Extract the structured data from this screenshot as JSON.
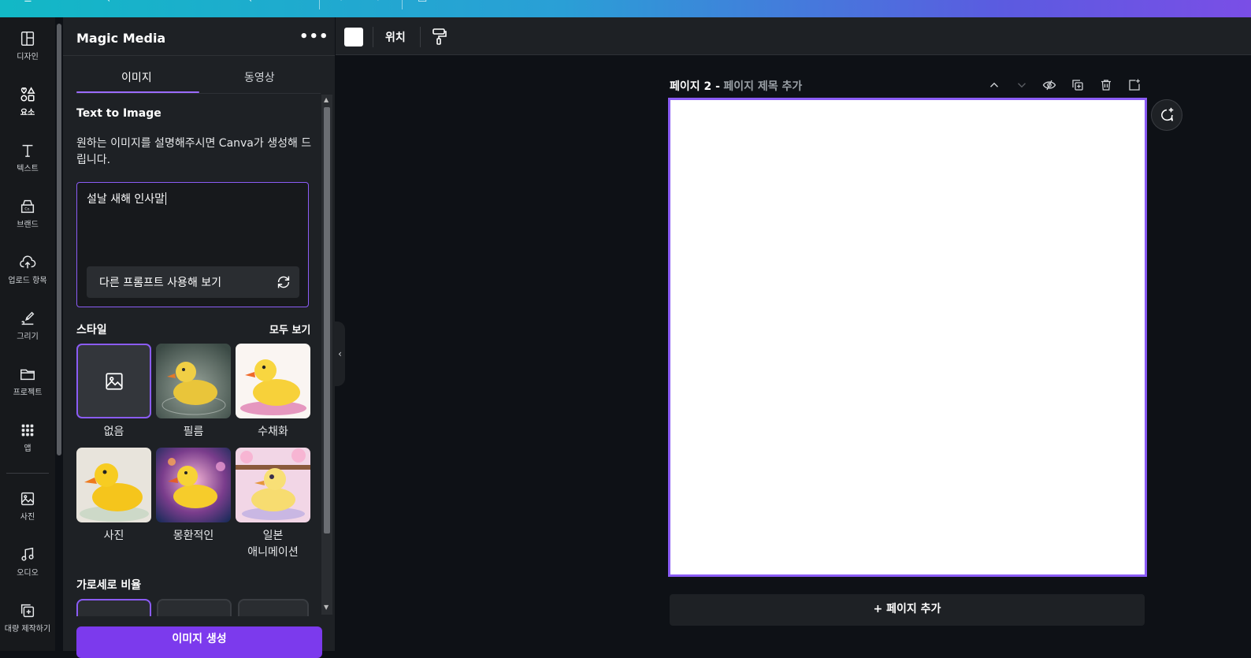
{
  "app": {
    "accent_color": "#8b5cf6",
    "button_color": "#7c3aed"
  },
  "topbar": {
    "gradient": [
      "#12b8c6",
      "#7a4ee6"
    ]
  },
  "rail": {
    "items": [
      {
        "label": "디자인",
        "icon": "layout-icon"
      },
      {
        "label": "요소",
        "icon": "shapes-icon"
      },
      {
        "label": "텍스트",
        "icon": "text-icon"
      },
      {
        "label": "브랜드",
        "icon": "brand-icon"
      },
      {
        "label": "업로드 항목",
        "icon": "upload-icon"
      },
      {
        "label": "그리기",
        "icon": "draw-icon"
      },
      {
        "label": "프로젝트",
        "icon": "folder-icon"
      },
      {
        "label": "앱",
        "icon": "apps-grid-icon"
      },
      {
        "label": "사진",
        "icon": "photo-icon"
      },
      {
        "label": "오디오",
        "icon": "music-icon"
      },
      {
        "label": "대량 제작하기",
        "icon": "bulk-create-icon"
      }
    ]
  },
  "panel": {
    "title": "Magic Media",
    "more": "•••",
    "tabs": [
      {
        "label": "이미지",
        "active": true
      },
      {
        "label": "동영상",
        "active": false
      }
    ],
    "text_to_image_title": "Text to Image",
    "description": "원하는 이미지를 설명해주시면 Canva가 생성해 드립니다.",
    "prompt_value": "설날 새해 인사말",
    "alt_prompt_label": "다른 프롬프트 사용해 보기",
    "style_title": "스타일",
    "see_all": "모두 보기",
    "styles": [
      {
        "label": "없음",
        "selected": true
      },
      {
        "label": "필름",
        "selected": false
      },
      {
        "label": "수채화",
        "selected": false
      },
      {
        "label": "사진",
        "selected": false
      },
      {
        "label": "몽환적인",
        "selected": false
      },
      {
        "label": "일본\n애니메이션",
        "selected": false
      }
    ],
    "ratio_title": "가로세로 비율",
    "generate_label": "이미지 생성"
  },
  "toolbar": {
    "swatch_color": "#ffffff",
    "position_label": "위치"
  },
  "canvas": {
    "page_number": "페이지 2 -",
    "page_title_placeholder": "페이지 제목 추가",
    "add_page_label": "+ 페이지 추가"
  }
}
